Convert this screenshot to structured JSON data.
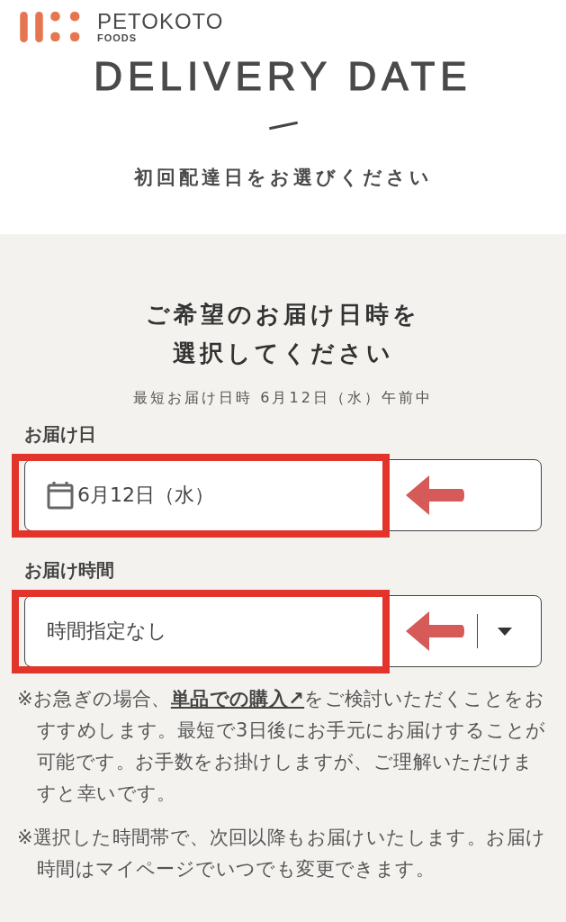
{
  "logo": {
    "name": "PETOKOTO",
    "sub": "FOODS"
  },
  "header": {
    "title": "DELIVERY DATE",
    "subtitle": "初回配達日をお選びください"
  },
  "form": {
    "heading_lines": [
      "ご希望のお届け日時を",
      "選択してください"
    ],
    "earliest": "最短お届け日時 6月12日（水）午前中",
    "fields": [
      {
        "kind": "date",
        "label": "お届け日",
        "value": "6月12日（水）"
      },
      {
        "kind": "select",
        "label": "お届け時間",
        "value": "時間指定なし"
      }
    ],
    "notes": [
      {
        "before": "※お急ぎの場合、",
        "link": "単品での購入↗",
        "after": "をご検討いただくことをおすすめします。最短で3日後にお手元にお届けすることが可能です。お手数をお掛けしますが、ご理解いただけますと幸いです。"
      },
      {
        "before": "※選択した時間帯で、次回以降もお届けいたします。お届け時間はマイページでいつでも変更できます。"
      }
    ]
  }
}
